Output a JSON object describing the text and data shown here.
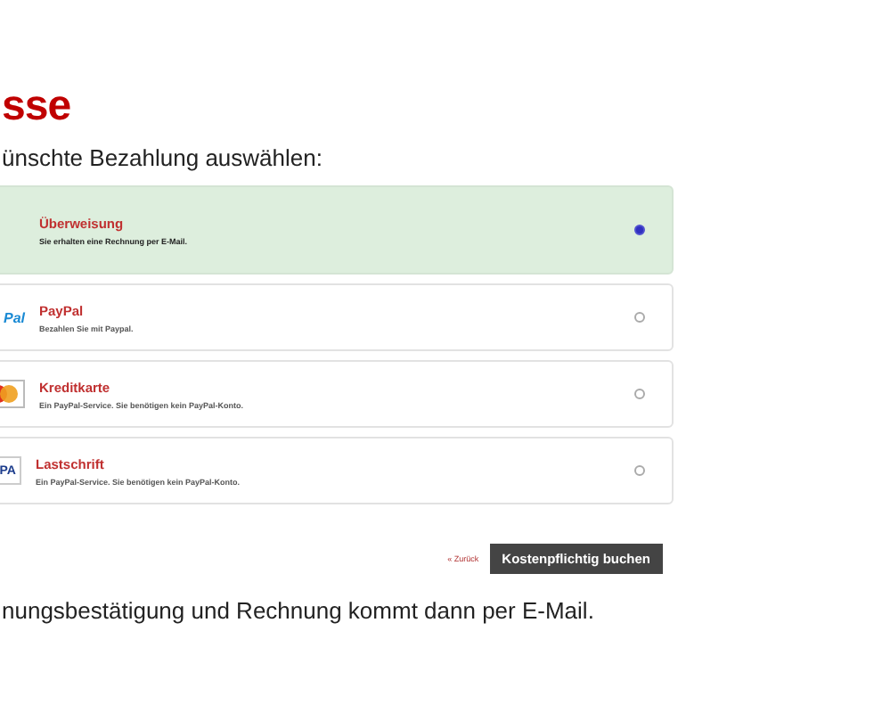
{
  "heading": "sse",
  "intro": "ünschte Bezahlung auswählen:",
  "methods": [
    {
      "kind": "none",
      "title": "Überweisung",
      "desc": "Sie erhalten eine Rechnung per E-Mail.",
      "selected": true
    },
    {
      "kind": "paypal",
      "logo_text": "Pal",
      "title": "PayPal",
      "desc": "Bezahlen Sie mit Paypal.",
      "selected": false
    },
    {
      "kind": "card",
      "title": "Kreditkarte",
      "desc": "Ein PayPal-Service. Sie benötigen kein PayPal-Konto.",
      "selected": false
    },
    {
      "kind": "sepa",
      "logo_text": "PA",
      "title": "Lastschrift",
      "desc": "Ein PayPal-Service. Sie benötigen kein PayPal-Konto.",
      "selected": false
    }
  ],
  "back_link": "« Zurück",
  "submit": "Kostenpflichtig buchen",
  "footer": "nungsbestätigung und Rechnung kommt dann per E-Mail."
}
